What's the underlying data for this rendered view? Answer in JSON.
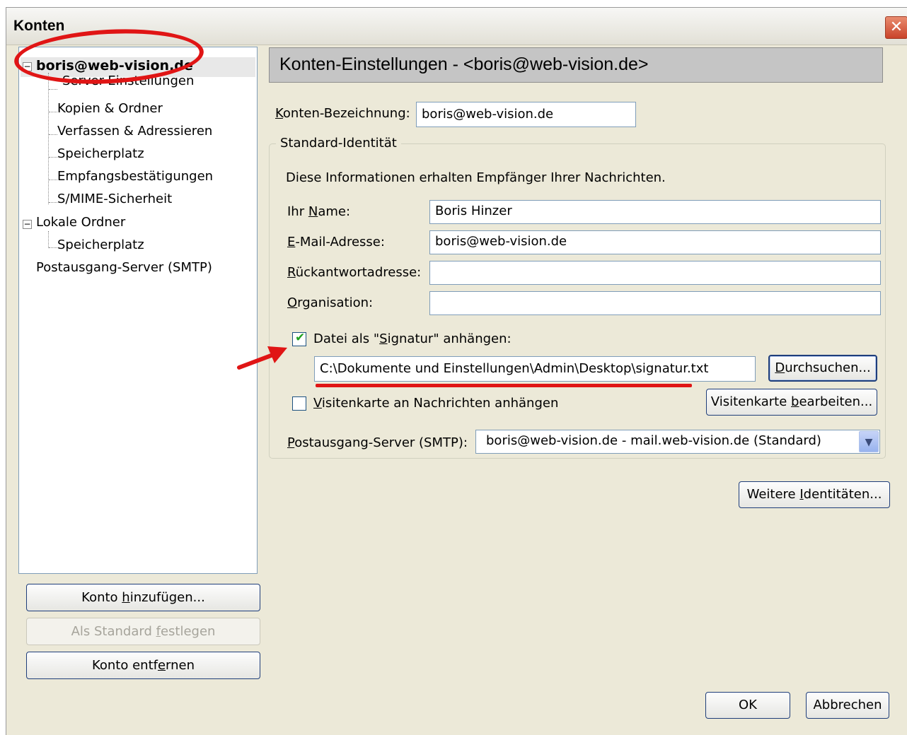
{
  "window": {
    "title": "Konten"
  },
  "tree": {
    "account": "boris@web-vision.de",
    "account_children": [
      "Server-Einstellungen",
      "Kopien & Ordner",
      "Verfassen & Adressieren",
      "Speicherplatz",
      "Empfangsbestätigungen",
      "S/MIME-Sicherheit"
    ],
    "local": "Lokale Ordner",
    "local_children": [
      "Speicherplatz"
    ],
    "smtp": "Postausgang-Server (SMTP)"
  },
  "left_buttons": {
    "add": {
      "pre": "Konto ",
      "key": "h",
      "post": "inzufügen..."
    },
    "default": {
      "pre": "Als Standard ",
      "key": "f",
      "post": "estlegen"
    },
    "remove": {
      "pre": "Konto entf",
      "key": "e",
      "post": "rnen"
    }
  },
  "settings": {
    "header": "Konten-Einstellungen - <boris@web-vision.de>",
    "account_name": {
      "key": "K",
      "rest": "onten-Bezeichnung:",
      "value": "boris@web-vision.de"
    },
    "identity": {
      "title": "Standard-Identität",
      "description": "Diese Informationen erhalten Empfänger Ihrer Nachrichten.",
      "name": {
        "pre": "Ihr ",
        "key": "N",
        "post": "ame:",
        "value": "Boris Hinzer"
      },
      "email": {
        "pre": "",
        "key": "E",
        "post": "-Mail-Adresse:",
        "value": "boris@web-vision.de"
      },
      "reply": {
        "pre": "",
        "key": "R",
        "post": "ückantwortadresse:",
        "value": ""
      },
      "org": {
        "pre": "",
        "key": "O",
        "post": "rganisation:",
        "value": ""
      },
      "signature": {
        "checked": true,
        "pre": "Datei als \"",
        "key": "S",
        "post": "ignatur\" anhängen:",
        "path": "C:\\Dokumente und Einstellungen\\Admin\\Desktop\\signatur.txt"
      },
      "browse": {
        "pre": "",
        "key": "D",
        "post": "urchsuchen..."
      },
      "vcard": {
        "checked": false,
        "pre": "",
        "key": "V",
        "post": "isitenkarte an Nachrichten anhängen"
      },
      "vcard_edit": {
        "pre": "Visitenkarte ",
        "key": "b",
        "post": "earbeiten..."
      },
      "smtp": {
        "pre": "",
        "key": "P",
        "post": "ostausgang-Server (SMTP):",
        "value": "boris@web-vision.de - mail.web-vision.de (Standard)"
      }
    },
    "more_identities": {
      "pre": "Weitere ",
      "key": "I",
      "post": "dentitäten..."
    }
  },
  "footer": {
    "ok": "OK",
    "cancel": "Abbrechen"
  },
  "colors": {
    "annotation_red": "#e01515",
    "window_bg": "#ece9d8",
    "border_blue": "#7f9db9"
  }
}
